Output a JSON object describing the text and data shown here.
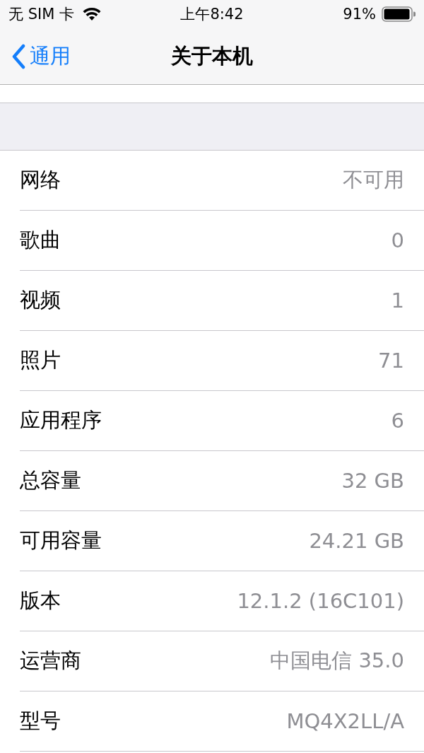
{
  "status_bar": {
    "carrier": "无 SIM 卡",
    "time": "上午8:42",
    "battery": "91%"
  },
  "nav": {
    "back": "通用",
    "title": "关于本机"
  },
  "rows": [
    {
      "label": "网络",
      "value": "不可用"
    },
    {
      "label": "歌曲",
      "value": "0"
    },
    {
      "label": "视频",
      "value": "1"
    },
    {
      "label": "照片",
      "value": "71"
    },
    {
      "label": "应用程序",
      "value": "6"
    },
    {
      "label": "总容量",
      "value": "32 GB"
    },
    {
      "label": "可用容量",
      "value": "24.21 GB"
    },
    {
      "label": "版本",
      "value": "12.1.2 (16C101)"
    },
    {
      "label": "运营商",
      "value": "中国电信 35.0"
    },
    {
      "label": "型号",
      "value": "MQ4X2LL/A"
    }
  ]
}
